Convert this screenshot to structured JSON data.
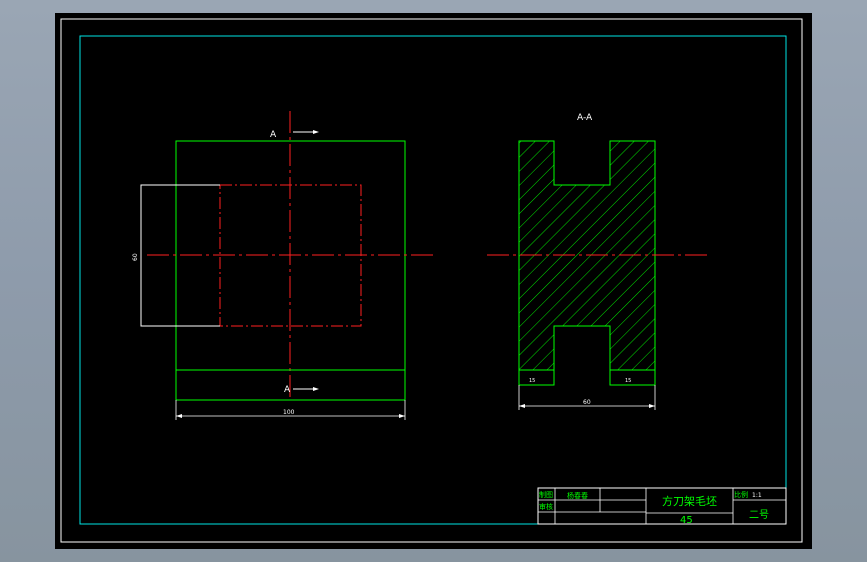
{
  "drawing": {
    "colors": {
      "frame": "#ffffff",
      "border": "#00e5e5",
      "outline": "#00ff00",
      "centerline": "#ff0000",
      "dimension": "#ffffff",
      "title_text": "#00ff00"
    },
    "section_mark_top": "A",
    "section_mark_bottom": "A",
    "section_view_title": "A-A",
    "dim_front_width": "100",
    "dim_front_height": "60",
    "dim_section_width": "60",
    "dim_slot_left": "15",
    "dim_slot_right": "15"
  },
  "title_block": {
    "drawn_label": "制图",
    "drawn_name": "杨春春",
    "check_label": "审核",
    "part_name": "方刀架毛坯",
    "material": "45",
    "scale_label": "比例",
    "scale_value": "1:1",
    "sheet_size": "二号"
  }
}
